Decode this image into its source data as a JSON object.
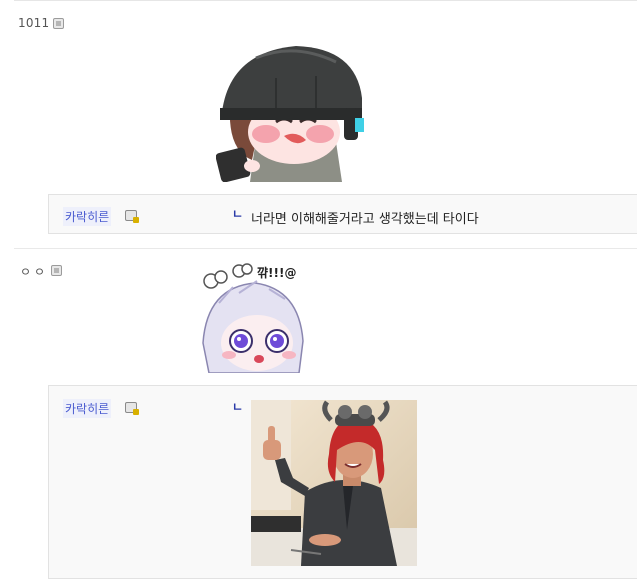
{
  "comments": [
    {
      "nickname": "1011",
      "icon": "ip-badge-icon",
      "image_alt": "chibi-helmet-sticker",
      "reply": {
        "nickname": "카락히른",
        "text": "너라면 이해해줄거라고 생각했는데 타이다",
        "arrow": "ㄴ"
      }
    },
    {
      "nickname": "ㅇㅇ",
      "icon": "ip-badge-icon",
      "image_alt": "chibi-angry-sticker",
      "sticker_text": "꺆!!!@",
      "reply": {
        "nickname": "카락히른",
        "text": "",
        "arrow": "ㄴ",
        "image_alt": "thumbs-up-photo"
      }
    }
  ],
  "colors": {
    "reply_bg": "#f9f9f9",
    "nick_blue": "#4a5bd0",
    "border": "#e2e2e2"
  }
}
